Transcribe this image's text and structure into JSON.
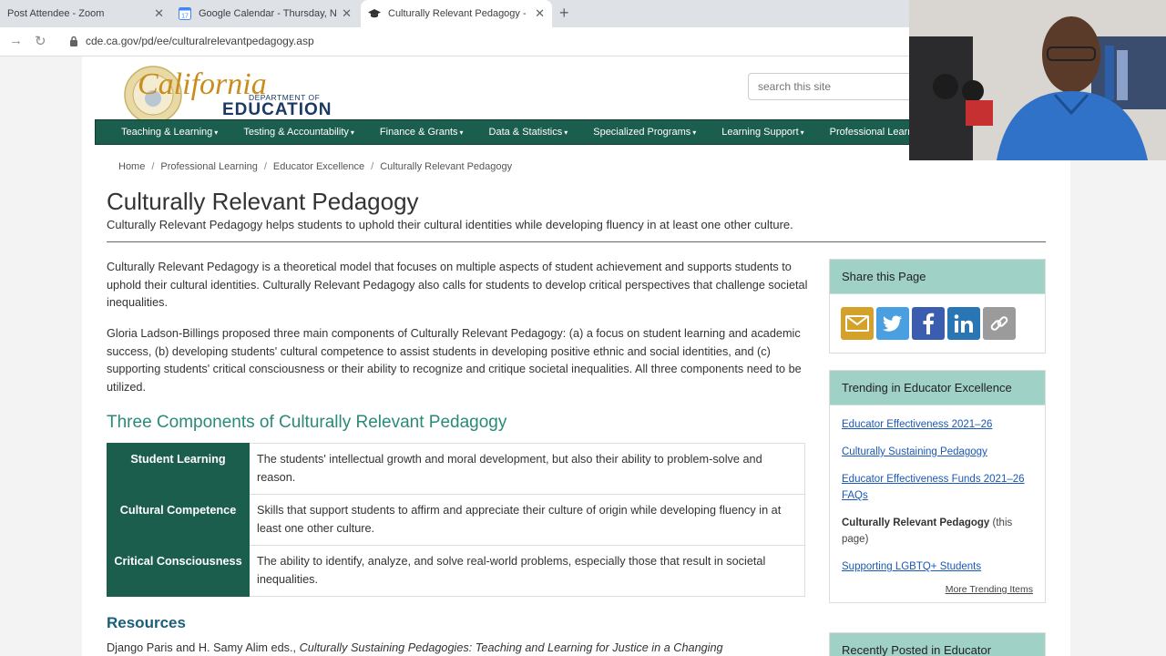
{
  "browser": {
    "tabs": [
      {
        "title": "Post Attendee - Zoom"
      },
      {
        "title": "Google Calendar - Thursday, No"
      },
      {
        "title": "Culturally Relevant Pedagogy - E"
      }
    ],
    "url": "cde.ca.gov/pd/ee/culturalrelevantpedagogy.asp",
    "calendar_badge": "17"
  },
  "header": {
    "logo_title": "California",
    "logo_dept": "DEPARTMENT OF",
    "logo_edu": "EDUCATION",
    "search_placeholder": "search this site"
  },
  "nav": [
    "Teaching & Learning",
    "Testing & Accountability",
    "Finance & Grants",
    "Data & Statistics",
    "Specialized Programs",
    "Learning Support",
    "Professional Learning"
  ],
  "breadcrumb": [
    "Home",
    "Professional Learning",
    "Educator Excellence",
    "Culturally Relevant Pedagogy"
  ],
  "page": {
    "title": "Culturally Relevant Pedagogy",
    "subtitle": "Culturally Relevant Pedagogy helps students to uphold their cultural identities while developing fluency in at least one other culture.",
    "para1": "Culturally Relevant Pedagogy is a theoretical model that focuses on multiple aspects of student achievement and supports students to uphold their cultural identities. Culturally Relevant Pedagogy also calls for students to develop critical perspectives that challenge societal inequalities.",
    "para2": "Gloria Ladson-Billings proposed three main components of Culturally Relevant Pedagogy: (a) a focus on student learning and academic success, (b) developing students' cultural competence to assist students in developing positive ethnic and social identities, and (c) supporting students' critical consciousness or their ability to recognize and critique societal inequalities. All three components need to be utilized.",
    "section_title": "Three Components of Culturally Relevant Pedagogy",
    "components": [
      {
        "term": "Student Learning",
        "definition": "The students' intellectual growth and moral development, but also their ability to problem-solve and reason."
      },
      {
        "term": "Cultural Competence",
        "definition": "Skills that support students to affirm and appreciate their culture of origin while developing fluency in at least one other culture."
      },
      {
        "term": "Critical Consciousness",
        "definition": "The ability to identify, analyze, and solve real-world problems, especially those that result in societal inequalities."
      }
    ],
    "resources_title": "Resources",
    "ref_authors": "Django Paris and H. Samy Alim eds., ",
    "ref_title": "Culturally Sustaining Pedagogies: Teaching and Learning for Justice in a Changing"
  },
  "sidebar": {
    "share_title": "Share this Page",
    "share_icons": [
      "email-icon",
      "twitter-icon",
      "facebook-icon",
      "linkedin-icon",
      "link-icon"
    ],
    "trending_title": "Trending in Educator Excellence",
    "trending_links": [
      "Educator Effectiveness 2021–26",
      "Culturally Sustaining Pedagogy",
      "Educator Effectiveness Funds 2021–26 FAQs"
    ],
    "current_page_bold": "Culturally Relevant Pedagogy",
    "current_page_suffix": " (this page)",
    "trending_last": "Supporting LGBTQ+ Students",
    "more_link": "More Trending Items",
    "recent_title": "Recently Posted in Educator"
  },
  "colors": {
    "nav_green": "#1b5e4d",
    "panel_teal": "#9fd1c6",
    "section_teal": "#2a8a7a",
    "link_blue": "#1a58b8"
  }
}
